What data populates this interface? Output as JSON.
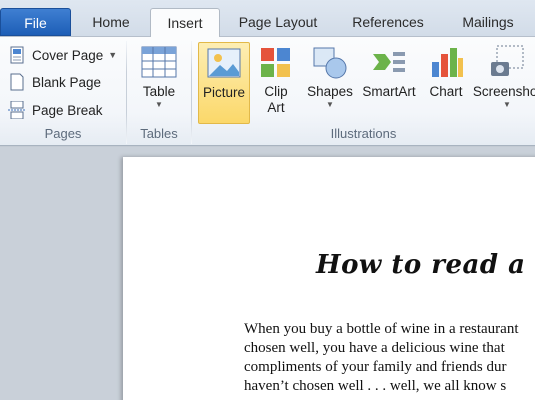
{
  "tabs": {
    "file": "File",
    "home": "Home",
    "insert": "Insert",
    "page_layout": "Page Layout",
    "references": "References",
    "mailings": "Mailings"
  },
  "ribbon": {
    "pages": {
      "cover_page": "Cover Page",
      "blank_page": "Blank Page",
      "page_break": "Page Break",
      "group_label": "Pages"
    },
    "tables": {
      "table": "Table",
      "group_label": "Tables"
    },
    "illustrations": {
      "picture": "Picture",
      "clip_art_line1": "Clip",
      "clip_art_line2": "Art",
      "shapes": "Shapes",
      "smartart": "SmartArt",
      "chart": "Chart",
      "screenshot": "Screenshot",
      "group_label": "Illustrations"
    }
  },
  "document": {
    "title": "How to read a",
    "body_lines": [
      "When you buy a bottle of wine in a restaurant",
      "chosen well, you have a delicious wine that",
      "compliments of your family and friends dur",
      "haven’t chosen well . . . well, we all know s"
    ]
  },
  "colors": {
    "file_tab": "#2a6ac4",
    "picture_highlight": "#fbd86a",
    "ribbon_bg": "#f3f6fa"
  }
}
